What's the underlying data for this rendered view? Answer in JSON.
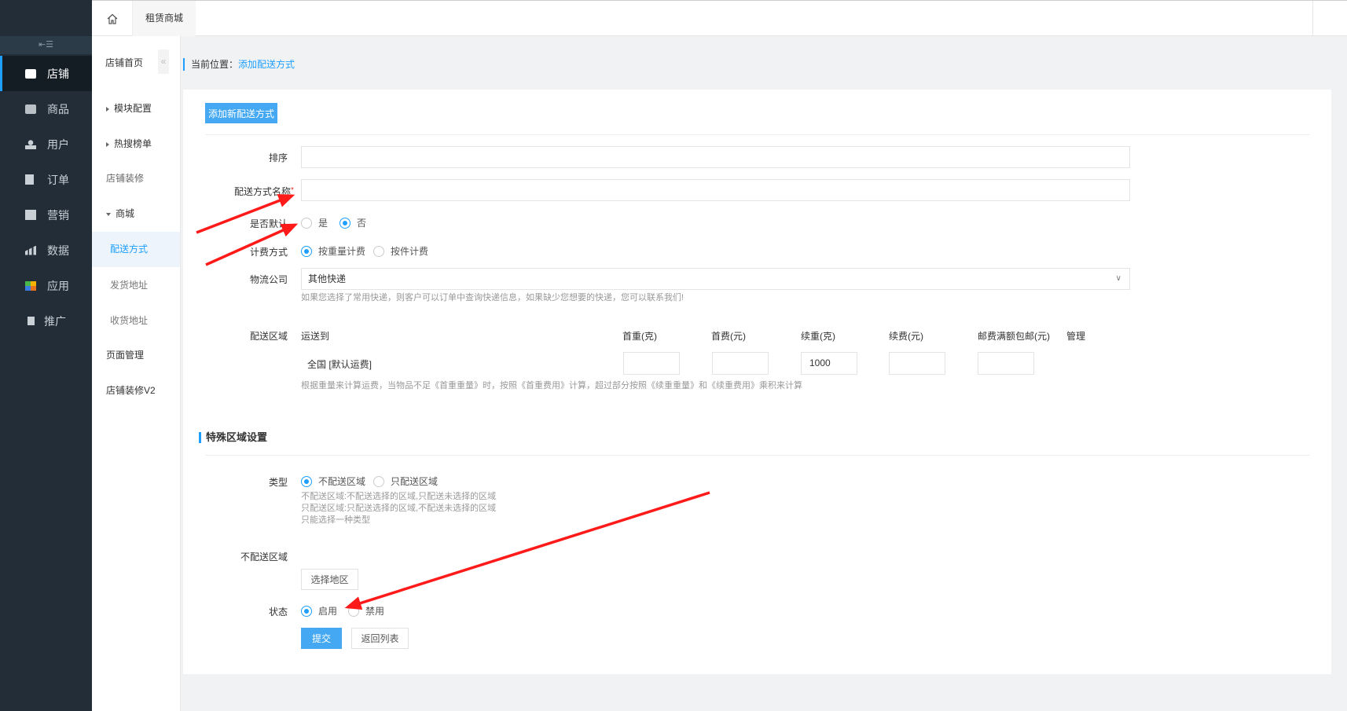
{
  "sidebar": {
    "toggle_icon": "menu-fold-icon",
    "items": [
      {
        "label": "店铺",
        "icon": "shop-icon",
        "active": true
      },
      {
        "label": "商品",
        "icon": "goods-icon"
      },
      {
        "label": "用户",
        "icon": "user-icon"
      },
      {
        "label": "订单",
        "icon": "order-icon"
      },
      {
        "label": "营销",
        "icon": "gift-icon"
      },
      {
        "label": "数据",
        "icon": "chart-icon"
      },
      {
        "label": "应用",
        "icon": "apps-icon"
      },
      {
        "label": "推广",
        "icon": "promote-icon"
      }
    ]
  },
  "subnav": {
    "title": "店铺首页",
    "items": [
      "模块配置",
      "热搜榜单",
      "店铺装修",
      "商城",
      "配送方式",
      "发货地址",
      "收货地址",
      "页面管理",
      "店铺装修V2"
    ]
  },
  "tabs": {
    "home_icon": "home-icon",
    "items": [
      "租赁商城"
    ]
  },
  "breadcrumb": {
    "label": "当前位置：",
    "current": "添加配送方式"
  },
  "form": {
    "header_button": "添加新配送方式",
    "sort_label": "排序",
    "sort_value": "",
    "name_label": "配送方式名称",
    "name_required": "*",
    "name_value": "",
    "default_label": "是否默认",
    "default_options": [
      "是",
      "否"
    ],
    "default_selected": "否",
    "billing_label": "计费方式",
    "billing_options": [
      "按重量计费",
      "按件计费"
    ],
    "billing_selected": "按重量计费",
    "company_label": "物流公司",
    "company_value": "其他快递",
    "company_help": "如果您选择了常用快递，则客户可以订单中查询快递信息，如果缺少您想要的快递，您可以联系我们!",
    "area_label": "配送区域",
    "area_columns": [
      "运送到",
      "首重(克)",
      "首费(元)",
      "续重(克)",
      "续费(元)",
      "邮费满额包邮(元)",
      "管理"
    ],
    "area_row": {
      "region": "全国 [默认运费]",
      "first_weight": "",
      "first_fee": "",
      "extra_weight": "1000",
      "extra_fee": "",
      "free_threshold": ""
    },
    "area_help": "根据重量来计算运费，当物品不足《首重重量》时，按照《首重费用》计算，超过部分按照《续重重量》和《续重费用》乘积来计算",
    "special_title": "特殊区域设置",
    "type_label": "类型",
    "type_options": [
      "不配送区域",
      "只配送区域"
    ],
    "type_selected": "不配送区域",
    "type_help": [
      "不配送区域:不配送选择的区域,只配送未选择的区域",
      "只配送区域:只配送选择的区域,不配送未选择的区域",
      "只能选择一种类型"
    ],
    "nodeliver_label": "不配送区域",
    "select_region_button": "选择地区",
    "status_label": "状态",
    "status_options": [
      "启用",
      "禁用"
    ],
    "status_selected": "启用",
    "submit_button": "提交",
    "back_button": "返回列表"
  },
  "colors": {
    "accent": "#1e9fff",
    "sidebar": "#222d38",
    "annotation": "#ff1a1a"
  }
}
